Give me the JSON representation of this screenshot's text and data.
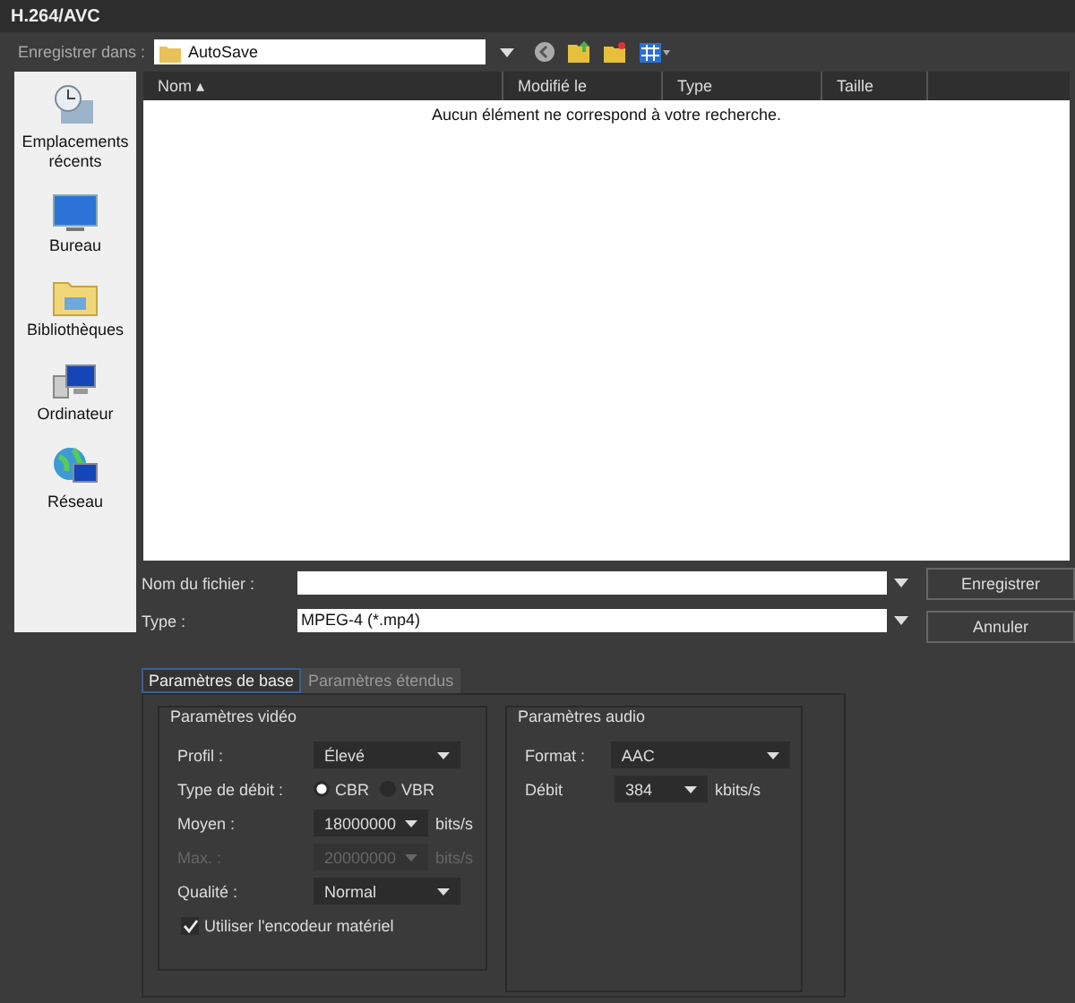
{
  "window": {
    "title": "H.264/AVC"
  },
  "location": {
    "label": "Enregistrer dans :",
    "value": "AutoSave"
  },
  "places": [
    {
      "label": "Emplacements récents",
      "kind": "recent"
    },
    {
      "label": "Bureau",
      "kind": "desktop"
    },
    {
      "label": "Bibliothèques",
      "kind": "library"
    },
    {
      "label": "Ordinateur",
      "kind": "computer"
    },
    {
      "label": "Réseau",
      "kind": "network"
    }
  ],
  "file_list": {
    "columns": [
      "Nom ▴",
      "Modifié le",
      "Type",
      "Taille"
    ],
    "empty_message": "Aucun élément ne correspond à votre recherche."
  },
  "file_name": {
    "label": "Nom du fichier :"
  },
  "file_type": {
    "label": "Type :",
    "value": "MPEG-4 (*.mp4)"
  },
  "buttons": [
    "Enregistrer",
    "Annuler"
  ],
  "tabs": [
    {
      "label": "Paramètres de base",
      "selected": true
    },
    {
      "label": "Paramètres étendus",
      "selected": false
    }
  ],
  "video": {
    "title": "Paramètres vidéo",
    "rows": [
      {
        "kind": "select",
        "label": "Profil :",
        "value": "Élevé",
        "disabled": false
      },
      {
        "kind": "radio",
        "label": "Type de débit :",
        "options": [
          {
            "label": "CBR",
            "selected": true
          },
          {
            "label": "VBR",
            "selected": false
          }
        ]
      },
      {
        "kind": "select",
        "label": "Moyen :",
        "value": "18000000",
        "unit": "bits/s",
        "disabled": false
      },
      {
        "kind": "select",
        "label": "Max. :",
        "value": "20000000",
        "unit": "bits/s",
        "disabled": true
      },
      {
        "kind": "select",
        "label": "Qualité :",
        "value": "Normal",
        "disabled": false
      },
      {
        "kind": "checkbox",
        "label": "Utiliser l'encodeur matériel",
        "checked": true
      }
    ]
  },
  "audio": {
    "title": "Paramètres audio",
    "rows": [
      {
        "kind": "select",
        "label": "Format :",
        "value": "AAC"
      },
      {
        "kind": "select",
        "label": "Débit",
        "value": "384",
        "unit": "kbits/s"
      }
    ]
  }
}
